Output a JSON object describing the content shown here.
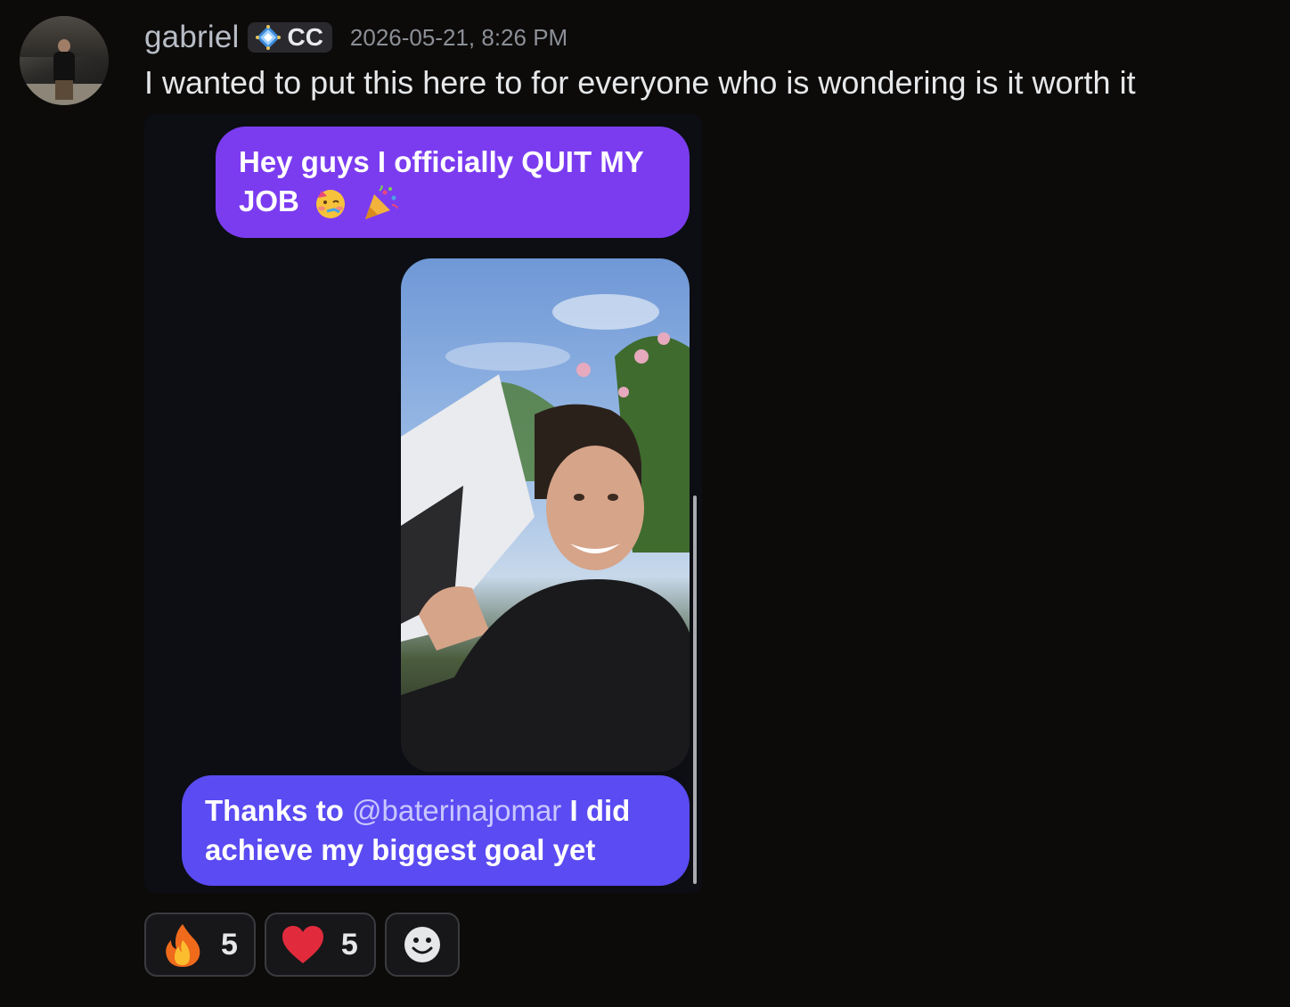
{
  "message": {
    "author": "gabriel",
    "tag_label": "CC",
    "timestamp": "2026-05-21, 8:26 PM",
    "text": "I wanted to put this here to for everyone who is wondering is it worth it"
  },
  "attachment": {
    "bubble_1_text": "Hey guys I officially QUIT MY JOB",
    "bubble_1_emojis": [
      "partying-face-emoji",
      "party-popper-emoji"
    ],
    "bubble_2_prefix": "Thanks to ",
    "bubble_2_mention": "@baterinajomar",
    "bubble_2_suffix": " I did achieve my biggest goal yet"
  },
  "reactions": [
    {
      "emoji": "fire-emoji",
      "count": "5"
    },
    {
      "emoji": "heart-emoji",
      "count": "5"
    },
    {
      "emoji": "add-reaction-icon"
    }
  ],
  "colors": {
    "background": "#0c0b0a",
    "bubble_purple": "#7b3cf0",
    "bubble_indigo": "#5a4bf2"
  }
}
